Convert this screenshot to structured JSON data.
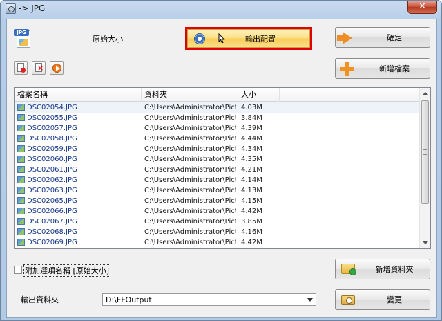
{
  "window": {
    "title": "-> JPG",
    "close_glyph": "✕"
  },
  "top": {
    "format_icon": "JPG",
    "size_label": "原始大小"
  },
  "buttons": {
    "output_config": "輸出配置",
    "ok": "確定",
    "add_file": "新增檔案",
    "add_folder": "新增資料夾",
    "change": "變更"
  },
  "toolbar": {
    "add_icon": "add-file-icon",
    "remove_icon": "remove-file-icon",
    "play_icon": "play-icon"
  },
  "list": {
    "columns": [
      "檔案名稱",
      "資料夾",
      "大小",
      ""
    ],
    "rows": [
      {
        "name": "DSC02054.JPG",
        "folder": "C:\\Users\\Administrator\\Pict...",
        "size": "4.03M"
      },
      {
        "name": "DSC02055.JPG",
        "folder": "C:\\Users\\Administrator\\Pict...",
        "size": "3.84M"
      },
      {
        "name": "DSC02057.JPG",
        "folder": "C:\\Users\\Administrator\\Pict...",
        "size": "4.39M"
      },
      {
        "name": "DSC02058.JPG",
        "folder": "C:\\Users\\Administrator\\Pict...",
        "size": "4.44M"
      },
      {
        "name": "DSC02059.JPG",
        "folder": "C:\\Users\\Administrator\\Pict...",
        "size": "4.34M"
      },
      {
        "name": "DSC02060.JPG",
        "folder": "C:\\Users\\Administrator\\Pict...",
        "size": "4.35M"
      },
      {
        "name": "DSC02061.JPG",
        "folder": "C:\\Users\\Administrator\\Pict...",
        "size": "4.21M"
      },
      {
        "name": "DSC02062.JPG",
        "folder": "C:\\Users\\Administrator\\Pict...",
        "size": "4.14M"
      },
      {
        "name": "DSC02063.JPG",
        "folder": "C:\\Users\\Administrator\\Pict...",
        "size": "4.13M"
      },
      {
        "name": "DSC02065.JPG",
        "folder": "C:\\Users\\Administrator\\Pict...",
        "size": "4.15M"
      },
      {
        "name": "DSC02066.JPG",
        "folder": "C:\\Users\\Administrator\\Pict...",
        "size": "4.42M"
      },
      {
        "name": "DSC02067.JPG",
        "folder": "C:\\Users\\Administrator\\Pict...",
        "size": "3.85M"
      },
      {
        "name": "DSC02068.JPG",
        "folder": "C:\\Users\\Administrator\\Pict...",
        "size": "4.16M"
      },
      {
        "name": "DSC02069.JPG",
        "folder": "C:\\Users\\Administrator\\Pict...",
        "size": "4.42M"
      }
    ]
  },
  "options": {
    "append_option_name_label": "附加選項名稱 [原始大小]",
    "append_option_name_checked": false
  },
  "output": {
    "label": "輸出資料夾",
    "path": "D:\\FFOutput"
  },
  "colors": {
    "highlight_border": "#e10000",
    "accent_orange": "#f29222"
  }
}
